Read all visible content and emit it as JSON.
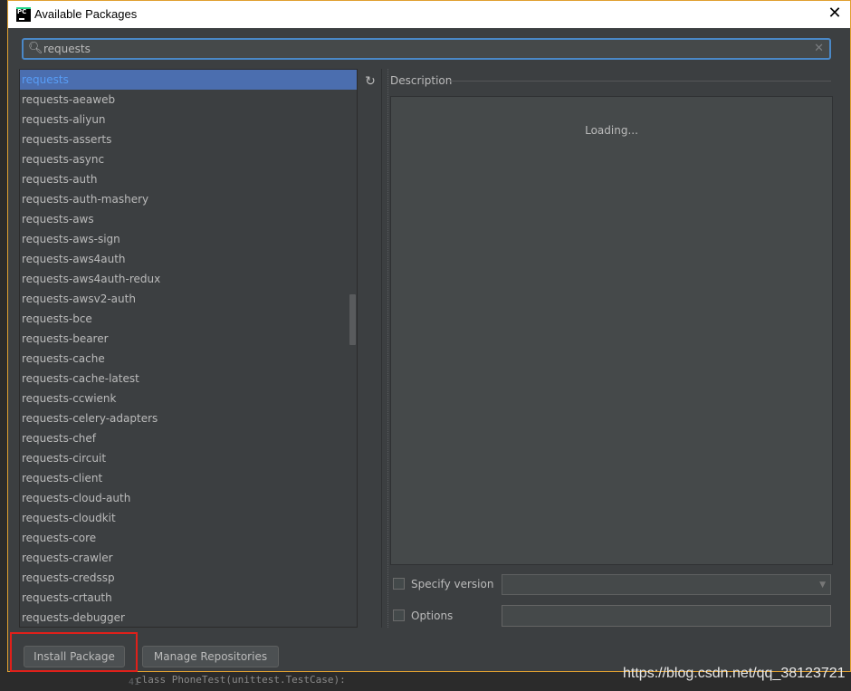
{
  "window": {
    "title": "Available Packages",
    "close_glyph": "✕",
    "icon_text": "PC"
  },
  "search": {
    "value": "requests",
    "clear_glyph": "✕"
  },
  "packages": [
    "requests",
    "requests-aeaweb",
    "requests-aliyun",
    "requests-asserts",
    "requests-async",
    "requests-auth",
    "requests-auth-mashery",
    "requests-aws",
    "requests-aws-sign",
    "requests-aws4auth",
    "requests-aws4auth-redux",
    "requests-awsv2-auth",
    "requests-bce",
    "requests-bearer",
    "requests-cache",
    "requests-cache-latest",
    "requests-ccwienk",
    "requests-celery-adapters",
    "requests-chef",
    "requests-circuit",
    "requests-client",
    "requests-cloud-auth",
    "requests-cloudkit",
    "requests-core",
    "requests-crawler",
    "requests-credssp",
    "requests-crtauth",
    "requests-debugger"
  ],
  "selected_index": 0,
  "description": {
    "label": "Description",
    "loading": "Loading..."
  },
  "specify_version": {
    "label": "Specify version",
    "checked": false
  },
  "options": {
    "label": "Options",
    "checked": false,
    "value": ""
  },
  "buttons": {
    "install": "Install Package",
    "manage": "Manage Repositories"
  },
  "background": {
    "code_line": "class PhoneTest(unittest.TestCase):",
    "line_number": "41"
  },
  "watermark": "https://blog.csdn.net/qq_38123721",
  "colors": {
    "accent": "#4a88c7",
    "selection": "#4b6eaf",
    "highlight_box": "#e0201a"
  }
}
